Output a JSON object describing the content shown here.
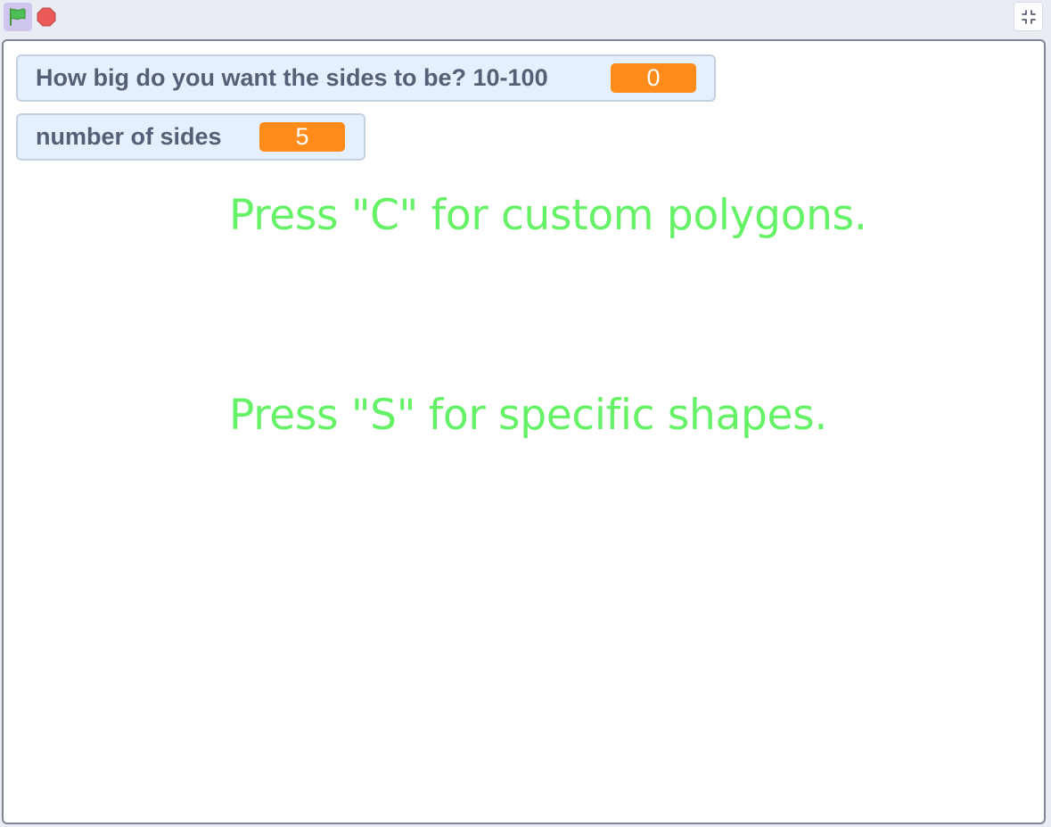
{
  "toolbar": {
    "green_flag_icon": "green-flag-icon",
    "stop_icon": "stop-icon",
    "fullscreen_exit_icon": "unfullscreen-icon",
    "flag_color": "#4cbf56",
    "stop_color": "#ec5959"
  },
  "stage": {
    "monitors": [
      {
        "label": "How big do you want the sides to be? 10-100",
        "value": "0"
      },
      {
        "label": "number of sides",
        "value": "5"
      }
    ],
    "texts": [
      "Press \"C\" for custom polygons.",
      "Press \"S\" for specific shapes."
    ],
    "text_color": "#66f266",
    "monitor_value_color": "#ff8c1a"
  }
}
